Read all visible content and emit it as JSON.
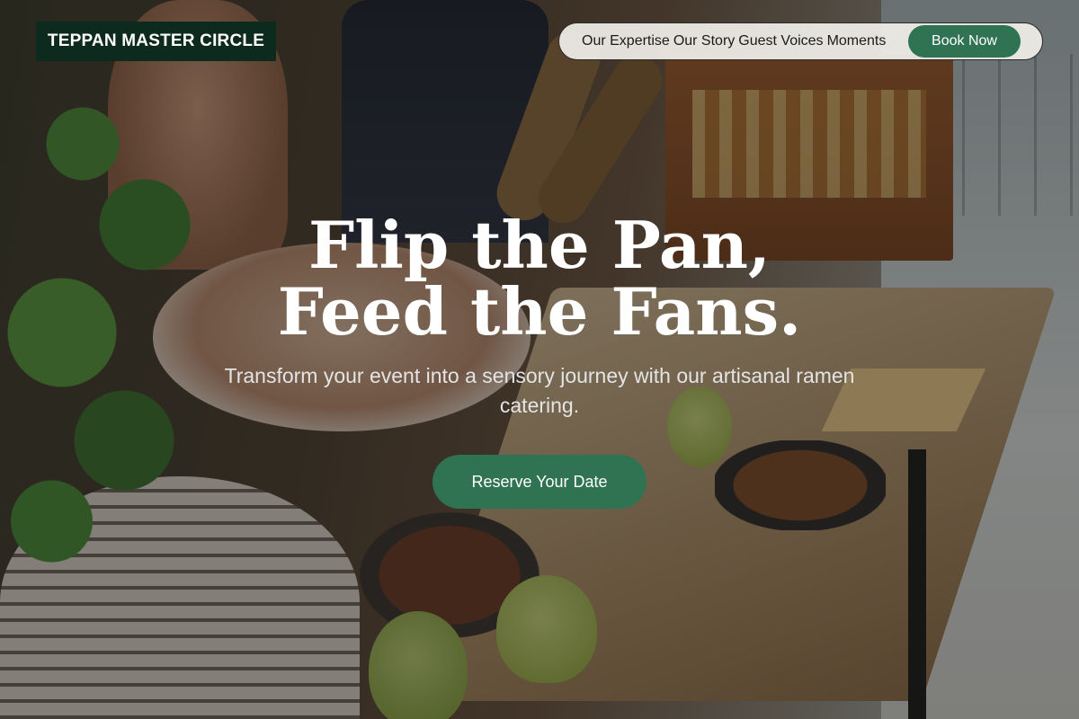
{
  "brand": {
    "name": "TEPPAN MASTER CIRCLE"
  },
  "nav": {
    "links": [
      "Our Expertise",
      "Our Story",
      "Guest Voices",
      "Moments"
    ],
    "book_label": "Book Now"
  },
  "hero": {
    "headline_line1": "Flip the Pan,",
    "headline_line2": "Feed the Fans.",
    "subtitle": "Transform your event into a sensory journey with our artisanal ramen catering.",
    "cta_label": "Reserve Your Date"
  },
  "colors": {
    "accent": "#2f7352",
    "logo_bg": "#0d2a1f",
    "nav_bg": "#f0eee8",
    "text_light": "#ffffff"
  }
}
